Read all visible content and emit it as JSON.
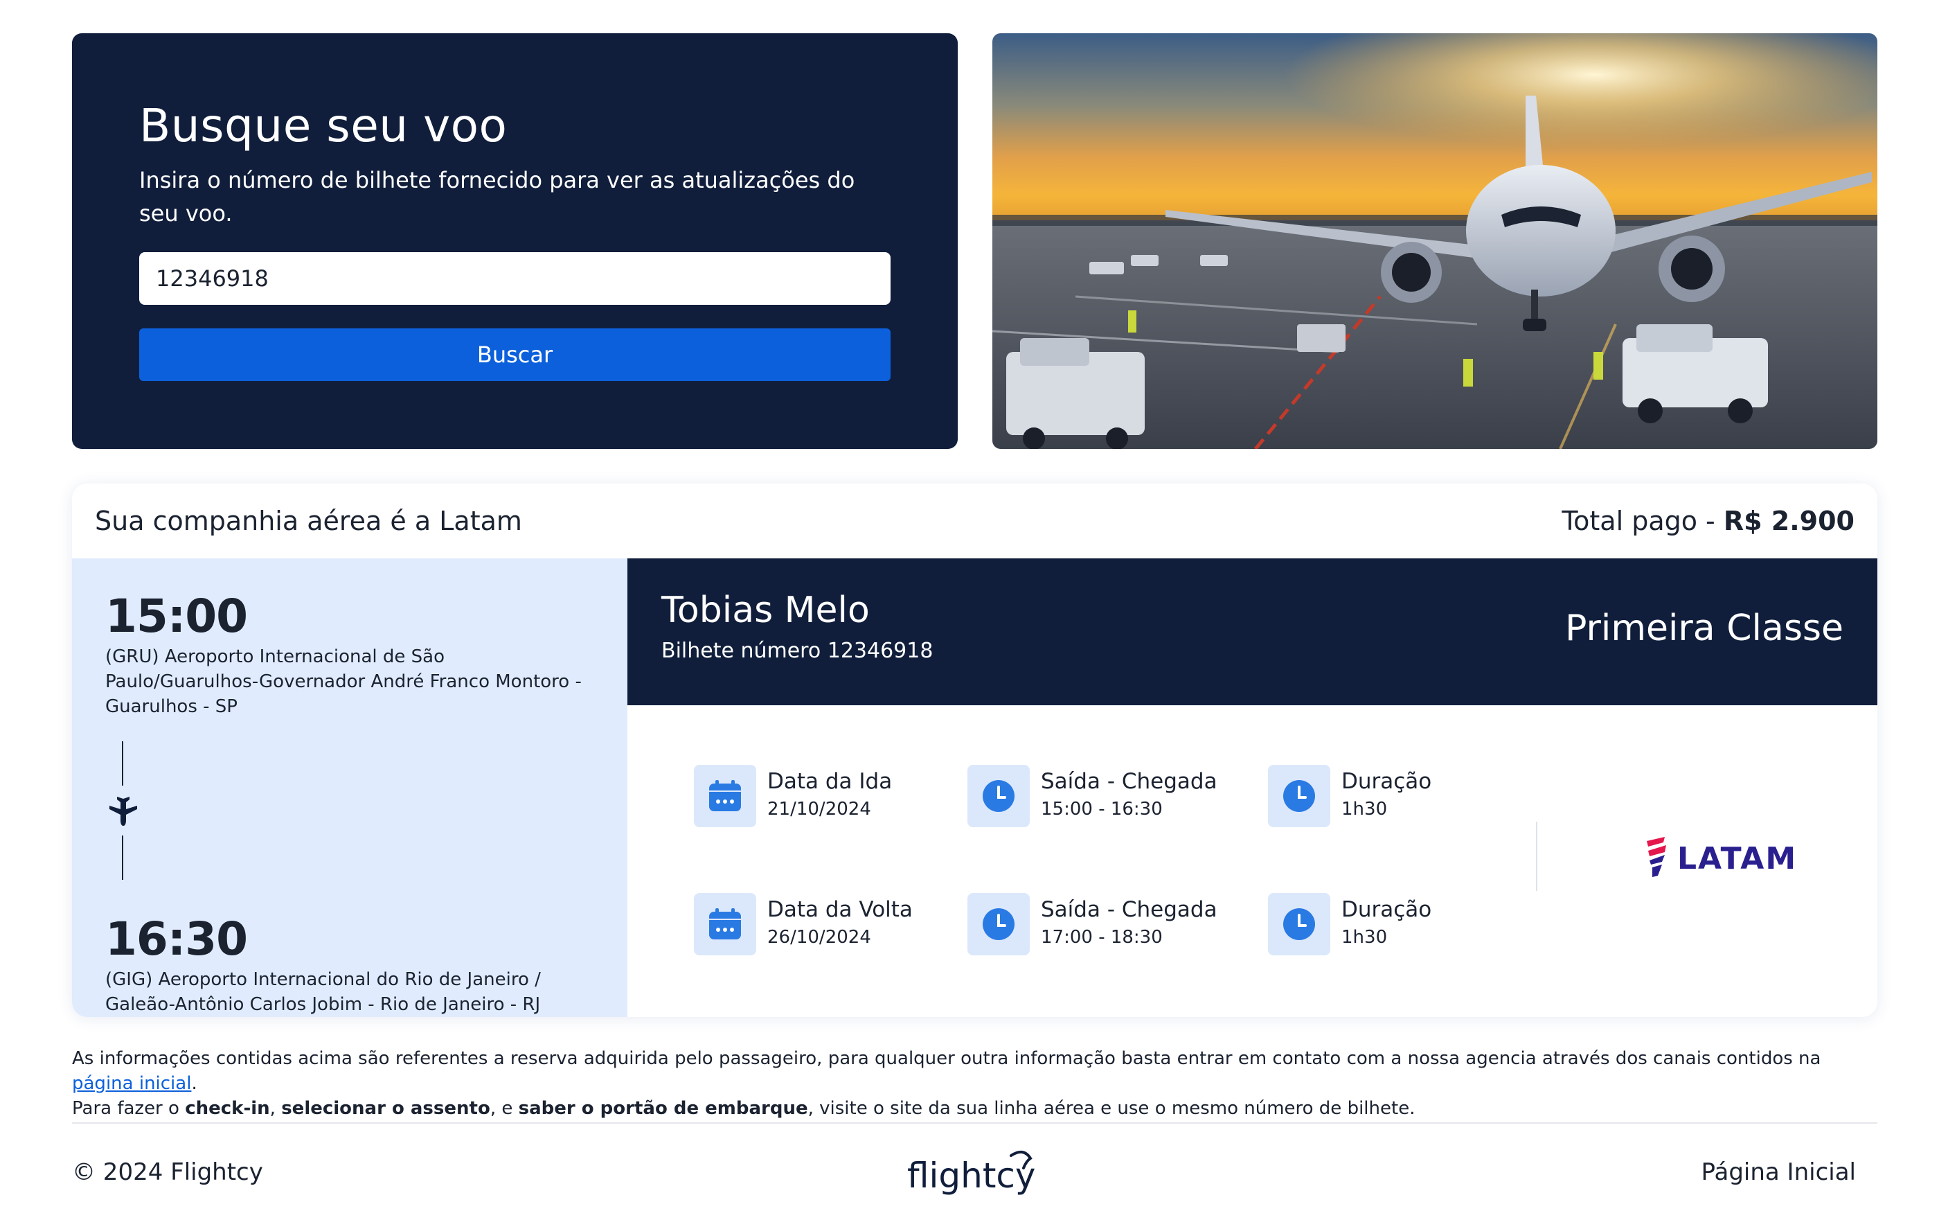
{
  "search": {
    "title": "Busque seu voo",
    "subtitle": "Insira o número de bilhete fornecido para ver as atualizações do seu voo.",
    "input_value": "12346918",
    "button_label": "Buscar"
  },
  "hero": {
    "image": "airplane-at-sunset"
  },
  "result": {
    "airline_text": "Sua companhia aérea é a Latam",
    "total_label": "Total pago - ",
    "total_value": "R$ 2.900",
    "departure": {
      "time": "15:00",
      "airport": "(GRU) Aeroporto Internacional de São Paulo/Guarulhos-Governador André Franco Montoro - Guarulhos - SP"
    },
    "arrival": {
      "time": "16:30",
      "airport": "(GIG) Aeroporto Internacional do Rio de Janeiro / Galeão-Antônio Carlos Jobim - Rio de Janeiro - RJ"
    },
    "passenger": {
      "name": "Tobias Melo",
      "ticket": "Bilhete número 12346918",
      "class": "Primeira Classe"
    },
    "outbound": {
      "date_label": "Data da Ida",
      "date": "21/10/2024",
      "times_label": "Saída - Chegada",
      "times": "15:00 - 16:30",
      "duration_label": "Duração",
      "duration": "1h30"
    },
    "return": {
      "date_label": "Data da Volta",
      "date": "26/10/2024",
      "times_label": "Saída - Chegada",
      "times": "17:00 - 18:30",
      "duration_label": "Duração",
      "duration": "1h30"
    },
    "airline_logo": "LATAM"
  },
  "note": {
    "line1": "As informações contidas acima são referentes a reserva adquirida pelo passageiro, para qualquer outra informação basta entrar em contato com a nossa agencia através dos canais contidos na ",
    "link": "página inicial",
    "line1_end": ".",
    "line2_a": "Para fazer o ",
    "checkin": "check-in",
    "sep1": ", ",
    "seat": "selecionar o assento",
    "sep2": ", e ",
    "gate": "saber o portão de embarque",
    "line2_b": ", visite o site da sua linha aérea e use o mesmo número de bilhete."
  },
  "footer": {
    "copyright": "© 2024 Flightcy",
    "logo": "flightcy",
    "home_link": "Página Inicial"
  },
  "colors": {
    "navy": "#101e3b",
    "primary": "#0c60db",
    "light_blue": "#e0ecfd",
    "latam_purple": "#2a1f8f",
    "latam_red": "#e4184c"
  }
}
